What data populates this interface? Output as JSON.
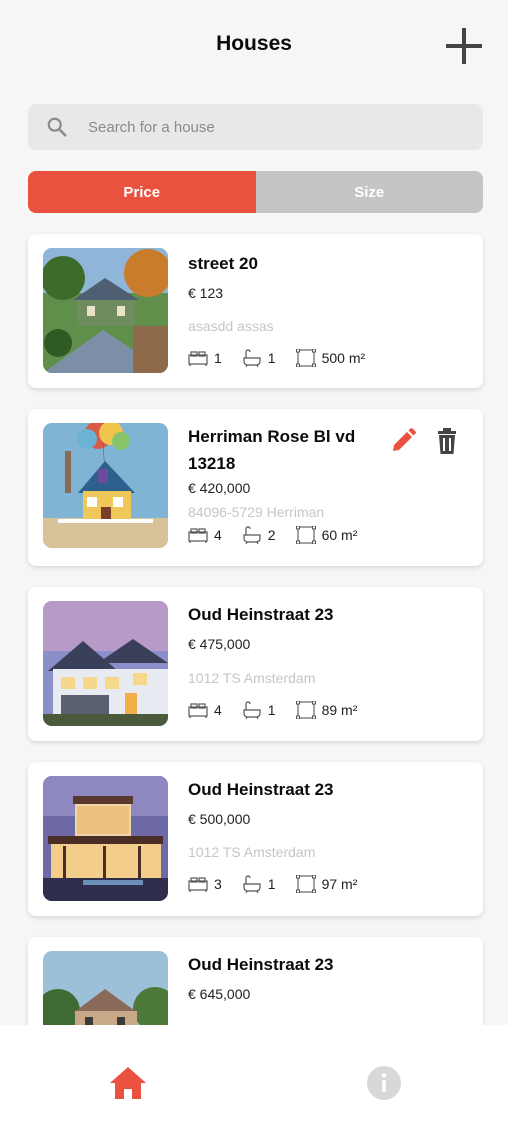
{
  "header": {
    "title": "Houses",
    "add_icon": "plus-icon"
  },
  "search": {
    "placeholder": "Search for a house",
    "icon": "search-icon"
  },
  "sort": {
    "options": [
      "Price",
      "Size"
    ],
    "active": "Price"
  },
  "colors": {
    "accent": "#e9523f",
    "inactive": "#c5c5c5",
    "muted_text": "#c6c6c6"
  },
  "listings": [
    {
      "street": "street 20",
      "price": "€ 123",
      "zip": "asasdd assas",
      "bedrooms": "1",
      "bathrooms": "1",
      "size": "500 m²",
      "editable": false
    },
    {
      "street": "Herriman Rose Bl vd 13218",
      "price": "€ 420,000",
      "zip": "84096-5729 Herriman",
      "bedrooms": "4",
      "bathrooms": "2",
      "size": "60 m²",
      "editable": true
    },
    {
      "street": "Oud Heinstraat 23",
      "price": "€ 475,000",
      "zip": "1012 TS Amsterdam",
      "bedrooms": "4",
      "bathrooms": "1",
      "size": "89 m²",
      "editable": false
    },
    {
      "street": "Oud Heinstraat 23",
      "price": "€ 500,000",
      "zip": "1012 TS Amsterdam",
      "bedrooms": "3",
      "bathrooms": "1",
      "size": "97 m²",
      "editable": false
    },
    {
      "street": "Oud Heinstraat 23",
      "price": "€ 645,000",
      "zip": "",
      "bedrooms": "",
      "bathrooms": "",
      "size": "",
      "editable": false
    }
  ],
  "bottom_nav": {
    "items": [
      "home-icon",
      "info-icon"
    ],
    "active": "home-icon"
  }
}
